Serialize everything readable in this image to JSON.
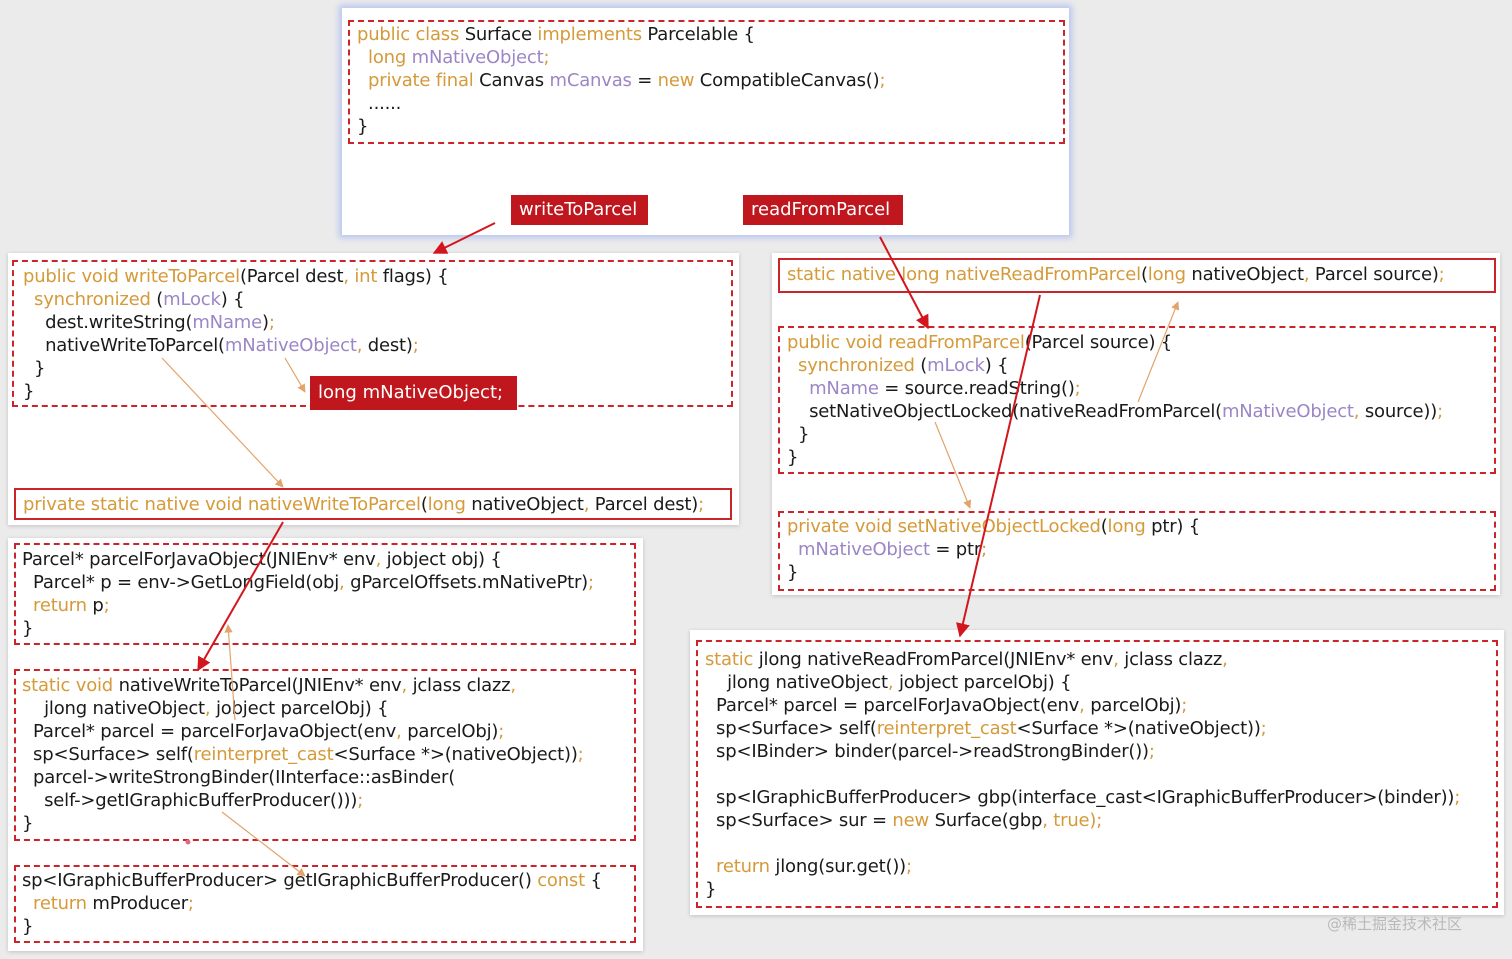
{
  "surface_class": {
    "lines": [
      [
        [
          "k",
          "public class "
        ],
        [
          "t",
          "Surface "
        ],
        [
          "k",
          "implements "
        ],
        [
          "t",
          "Parcelable {"
        ]
      ],
      [
        [
          "t",
          "  "
        ],
        [
          "k",
          "long "
        ],
        [
          "v",
          "mNativeObject"
        ],
        [
          "k",
          ";"
        ]
      ],
      [
        [
          "t",
          "  "
        ],
        [
          "k",
          "private final "
        ],
        [
          "t",
          "Canvas "
        ],
        [
          "v",
          "mCanvas "
        ],
        [
          "t",
          "= "
        ],
        [
          "k",
          "new "
        ],
        [
          "t",
          "CompatibleCanvas()"
        ],
        [
          "k",
          ";"
        ]
      ],
      [
        [
          "t",
          "  ......"
        ]
      ],
      [
        [
          "t",
          "}"
        ]
      ]
    ],
    "write_label": "writeToParcel",
    "read_label": "readFromParcel"
  },
  "write_to_parcel": {
    "lines": [
      [
        [
          "k",
          "public void "
        ],
        [
          "k",
          "writeToParcel"
        ],
        [
          "t",
          "(Parcel dest"
        ],
        [
          "k",
          ", int "
        ],
        [
          "t",
          "flags) {"
        ]
      ],
      [
        [
          "t",
          "  "
        ],
        [
          "k",
          "synchronized "
        ],
        [
          "t",
          "("
        ],
        [
          "v",
          "mLock"
        ],
        [
          "t",
          ") {"
        ]
      ],
      [
        [
          "t",
          "    dest.writeString("
        ],
        [
          "v",
          "mName"
        ],
        [
          "t",
          ")"
        ],
        [
          "k",
          ";"
        ]
      ],
      [
        [
          "t",
          "    nativeWriteToParcel("
        ],
        [
          "v",
          "mNativeObject"
        ],
        [
          "k",
          ", "
        ],
        [
          "t",
          "dest)"
        ],
        [
          "k",
          ";"
        ]
      ],
      [
        [
          "t",
          "  }"
        ]
      ],
      [
        [
          "t",
          "}"
        ]
      ]
    ],
    "native_object_label": "long mNativeObject;"
  },
  "native_write_decl": {
    "lines": [
      [
        [
          "k",
          "private static native void "
        ],
        [
          "k",
          "nativeWriteToParcel"
        ],
        [
          "t",
          "("
        ],
        [
          "k",
          "long "
        ],
        [
          "t",
          "nativeObject"
        ],
        [
          "k",
          ", "
        ],
        [
          "t",
          "Parcel dest)"
        ],
        [
          "k",
          ";"
        ]
      ]
    ]
  },
  "native_read_decl": {
    "lines": [
      [
        [
          "k",
          "static native long "
        ],
        [
          "k",
          "nativeReadFromParcel"
        ],
        [
          "t",
          "("
        ],
        [
          "k",
          "long "
        ],
        [
          "t",
          "nativeObject"
        ],
        [
          "k",
          ", "
        ],
        [
          "t",
          "Parcel source)"
        ],
        [
          "k",
          ";"
        ]
      ]
    ]
  },
  "read_from_parcel": {
    "lines": [
      [
        [
          "k",
          "public void "
        ],
        [
          "k",
          "readFromParcel"
        ],
        [
          "t",
          "(Parcel source) {"
        ]
      ],
      [
        [
          "t",
          "  "
        ],
        [
          "k",
          "synchronized "
        ],
        [
          "t",
          "("
        ],
        [
          "v",
          "mLock"
        ],
        [
          "t",
          ") {"
        ]
      ],
      [
        [
          "t",
          "    "
        ],
        [
          "v",
          "mName "
        ],
        [
          "t",
          "= source.readString()"
        ],
        [
          "k",
          ";"
        ]
      ],
      [
        [
          "t",
          "    setNativeObjectLocked(nativeReadFromParcel("
        ],
        [
          "v",
          "mNativeObject"
        ],
        [
          "k",
          ", "
        ],
        [
          "t",
          "source))"
        ],
        [
          "k",
          ";"
        ]
      ],
      [
        [
          "t",
          "  }"
        ]
      ],
      [
        [
          "t",
          "}"
        ]
      ]
    ]
  },
  "set_native_object": {
    "lines": [
      [
        [
          "k",
          "private void "
        ],
        [
          "k",
          "setNativeObjectLocked"
        ],
        [
          "t",
          "("
        ],
        [
          "k",
          "long "
        ],
        [
          "t",
          "ptr) {"
        ]
      ],
      [
        [
          "t",
          "  "
        ],
        [
          "v",
          "mNativeObject "
        ],
        [
          "t",
          "= ptr"
        ],
        [
          "k",
          ";"
        ]
      ],
      [
        [
          "t",
          "}"
        ]
      ]
    ]
  },
  "parcel_for_java": {
    "lines": [
      [
        [
          "t",
          "Parcel* parcelForJavaObject(JNIEnv* env"
        ],
        [
          "k",
          ", "
        ],
        [
          "t",
          "jobject obj) {"
        ]
      ],
      [
        [
          "t",
          "  Parcel* p = env->GetLongField(obj"
        ],
        [
          "k",
          ", "
        ],
        [
          "t",
          "gParcelOffsets.mNativePtr)"
        ],
        [
          "k",
          ";"
        ]
      ],
      [
        [
          "t",
          "  "
        ],
        [
          "k",
          "return "
        ],
        [
          "t",
          "p"
        ],
        [
          "k",
          ";"
        ]
      ],
      [
        [
          "t",
          "}"
        ]
      ]
    ]
  },
  "native_write_impl": {
    "lines": [
      [
        [
          "k",
          "static void "
        ],
        [
          "t",
          "nativeWriteToParcel(JNIEnv* env"
        ],
        [
          "k",
          ", "
        ],
        [
          "t",
          "jclass clazz"
        ],
        [
          "k",
          ","
        ]
      ],
      [
        [
          "t",
          "    jlong nativeObject"
        ],
        [
          "k",
          ", "
        ],
        [
          "t",
          "jobject parcelObj) {"
        ]
      ],
      [
        [
          "t",
          "  Parcel* parcel = parcelForJavaObject(env"
        ],
        [
          "k",
          ", "
        ],
        [
          "t",
          "parcelObj)"
        ],
        [
          "k",
          ";"
        ]
      ],
      [
        [
          "t",
          "  sp<Surface> self("
        ],
        [
          "k",
          "reinterpret_cast"
        ],
        [
          "t",
          "<Surface *>(nativeObject))"
        ],
        [
          "k",
          ";"
        ]
      ],
      [
        [
          "t",
          "  parcel->writeStrongBinder(IInterface::asBinder("
        ]
      ],
      [
        [
          "t",
          "    self->getIGraphicBufferProducer()))"
        ],
        [
          "k",
          ";"
        ]
      ],
      [
        [
          "t",
          "}"
        ]
      ]
    ]
  },
  "get_producer": {
    "lines": [
      [
        [
          "t",
          "sp<IGraphicBufferProducer> getIGraphicBufferProducer() "
        ],
        [
          "k",
          "const "
        ],
        [
          "t",
          "{"
        ]
      ],
      [
        [
          "t",
          "  "
        ],
        [
          "k",
          "return "
        ],
        [
          "t",
          "mProducer"
        ],
        [
          "k",
          ";"
        ]
      ],
      [
        [
          "t",
          "}"
        ]
      ]
    ]
  },
  "native_read_impl": {
    "lines": [
      [
        [
          "k",
          "static "
        ],
        [
          "t",
          "jlong nativeReadFromParcel(JNIEnv* env"
        ],
        [
          "k",
          ", "
        ],
        [
          "t",
          "jclass clazz"
        ],
        [
          "k",
          ","
        ]
      ],
      [
        [
          "t",
          "    jlong nativeObject"
        ],
        [
          "k",
          ", "
        ],
        [
          "t",
          "jobject parcelObj) {"
        ]
      ],
      [
        [
          "t",
          "  Parcel* parcel = parcelForJavaObject(env"
        ],
        [
          "k",
          ", "
        ],
        [
          "t",
          "parcelObj)"
        ],
        [
          "k",
          ";"
        ]
      ],
      [
        [
          "t",
          "  sp<Surface> self("
        ],
        [
          "k",
          "reinterpret_cast"
        ],
        [
          "t",
          "<Surface *>(nativeObject))"
        ],
        [
          "k",
          ";"
        ]
      ],
      [
        [
          "t",
          "  sp<IBinder> binder(parcel->readStrongBinder())"
        ],
        [
          "k",
          ";"
        ]
      ],
      [
        [
          "t",
          ""
        ]
      ],
      [
        [
          "t",
          "  sp<IGraphicBufferProducer> gbp(interface_cast<IGraphicBufferProducer>(binder))"
        ],
        [
          "k",
          ";"
        ]
      ],
      [
        [
          "t",
          "  sp<Surface> sur = "
        ],
        [
          "k",
          "new "
        ],
        [
          "t",
          "Surface(gbp"
        ],
        [
          "k",
          ", true)"
        ],
        [
          "k",
          ";"
        ]
      ],
      [
        [
          "t",
          ""
        ]
      ],
      [
        [
          "t",
          "  "
        ],
        [
          "k",
          "return "
        ],
        [
          "t",
          "jlong(sur.get())"
        ],
        [
          "k",
          ";"
        ]
      ],
      [
        [
          "t",
          "}"
        ]
      ]
    ]
  },
  "watermark": "@稀土掘金技术社区",
  "colors": {
    "keyword": "#d59a39",
    "variable": "#9b86c6",
    "box": "#c9252b",
    "red_arrow": "#d3161d",
    "orange_arrow": "#e3a36a"
  }
}
